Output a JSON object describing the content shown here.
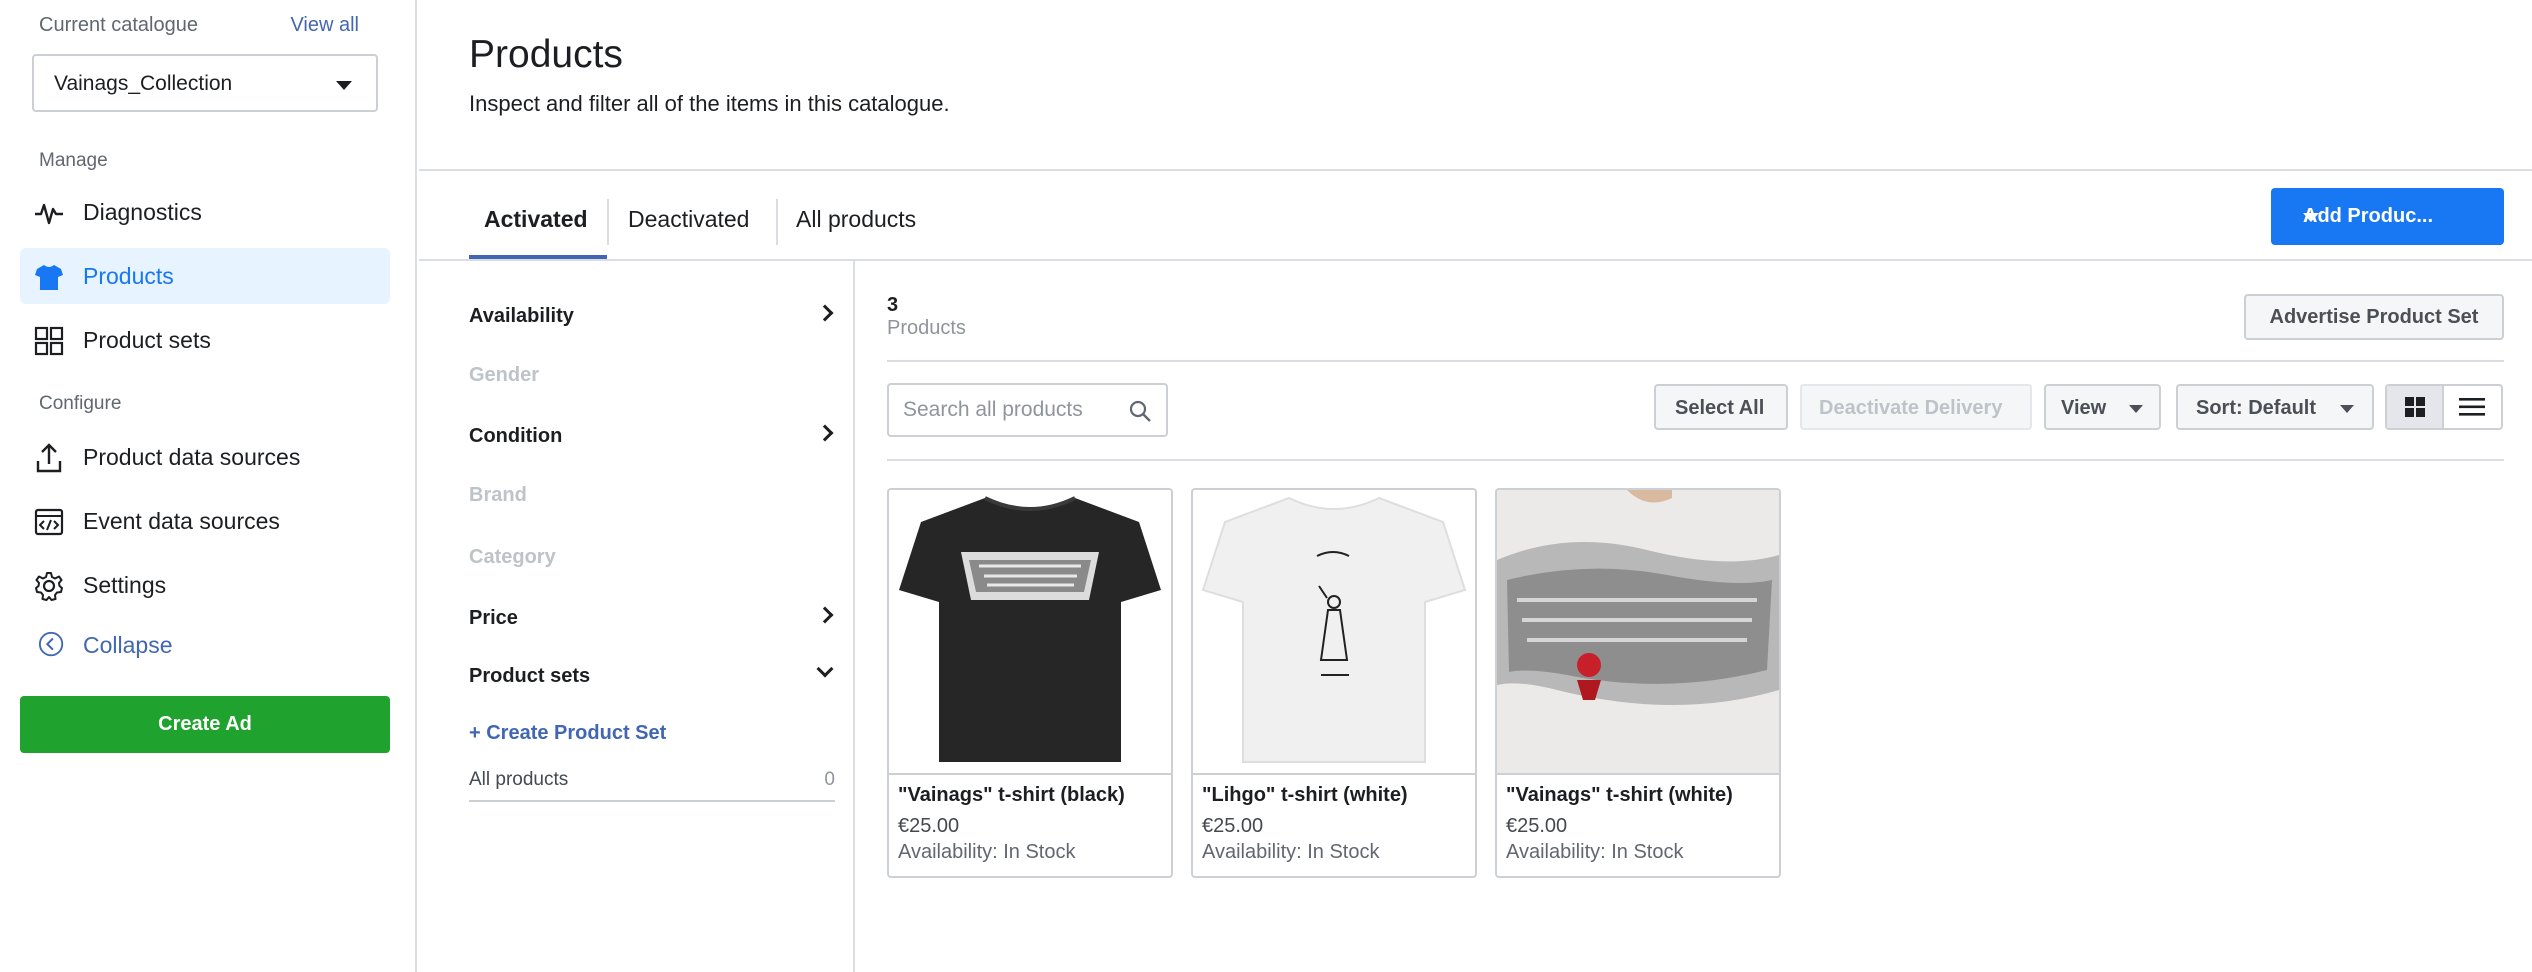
{
  "sidebar": {
    "catalogue_label": "Current catalogue",
    "view_all": "View all",
    "catalogue_value": "Vainags_Collection",
    "manage_label": "Manage",
    "configure_label": "Configure",
    "items": [
      {
        "label": "Diagnostics",
        "icon": "pulse-icon"
      },
      {
        "label": "Products",
        "icon": "tshirt-icon",
        "active": true
      },
      {
        "label": "Product sets",
        "icon": "grid-icon"
      },
      {
        "label": "Product data sources",
        "icon": "upload-icon"
      },
      {
        "label": "Event data sources",
        "icon": "code-window-icon"
      },
      {
        "label": "Settings",
        "icon": "gear-icon"
      }
    ],
    "collapse_label": "Collapse",
    "create_ad": "Create Ad"
  },
  "header": {
    "title": "Products",
    "subtitle": "Inspect and filter all of the items in this catalogue."
  },
  "tabs": [
    {
      "label": "Activated",
      "active": true
    },
    {
      "label": "Deactivated"
    },
    {
      "label": "All products"
    }
  ],
  "add_products_label": "Add Produc...",
  "filters": {
    "items": [
      {
        "label": "Availability",
        "enabled": true,
        "expandable": true
      },
      {
        "label": "Gender",
        "enabled": false
      },
      {
        "label": "Condition",
        "enabled": true,
        "expandable": true
      },
      {
        "label": "Brand",
        "enabled": false
      },
      {
        "label": "Category",
        "enabled": false
      },
      {
        "label": "Price",
        "enabled": true,
        "expandable": true
      },
      {
        "label": "Product sets",
        "enabled": true,
        "expanded": true
      }
    ],
    "create_set": "+ Create Product Set",
    "all_products_label": "All products",
    "all_products_count": "0"
  },
  "results": {
    "count": "3",
    "count_label": "Products",
    "advertise_label": "Advertise Product Set",
    "search_placeholder": "Search all products",
    "select_all": "Select All",
    "deactivate_delivery": "Deactivate Delivery",
    "view_label": "View",
    "sort_label": "Sort: Default"
  },
  "products": [
    {
      "name": "\"Vainags\" t-shirt (black)",
      "price": "€25.00",
      "availability": "Availability: In Stock"
    },
    {
      "name": "\"Lihgo\" t-shirt (white)",
      "price": "€25.00",
      "availability": "Availability: In Stock"
    },
    {
      "name": "\"Vainags\" t-shirt (white)",
      "price": "€25.00",
      "availability": "Availability: In Stock"
    }
  ],
  "colors": {
    "accent_blue": "#1877f2",
    "link_blue": "#4267b2",
    "create_ad_green": "#1fa22e",
    "active_nav_bg": "#e7f3ff"
  }
}
